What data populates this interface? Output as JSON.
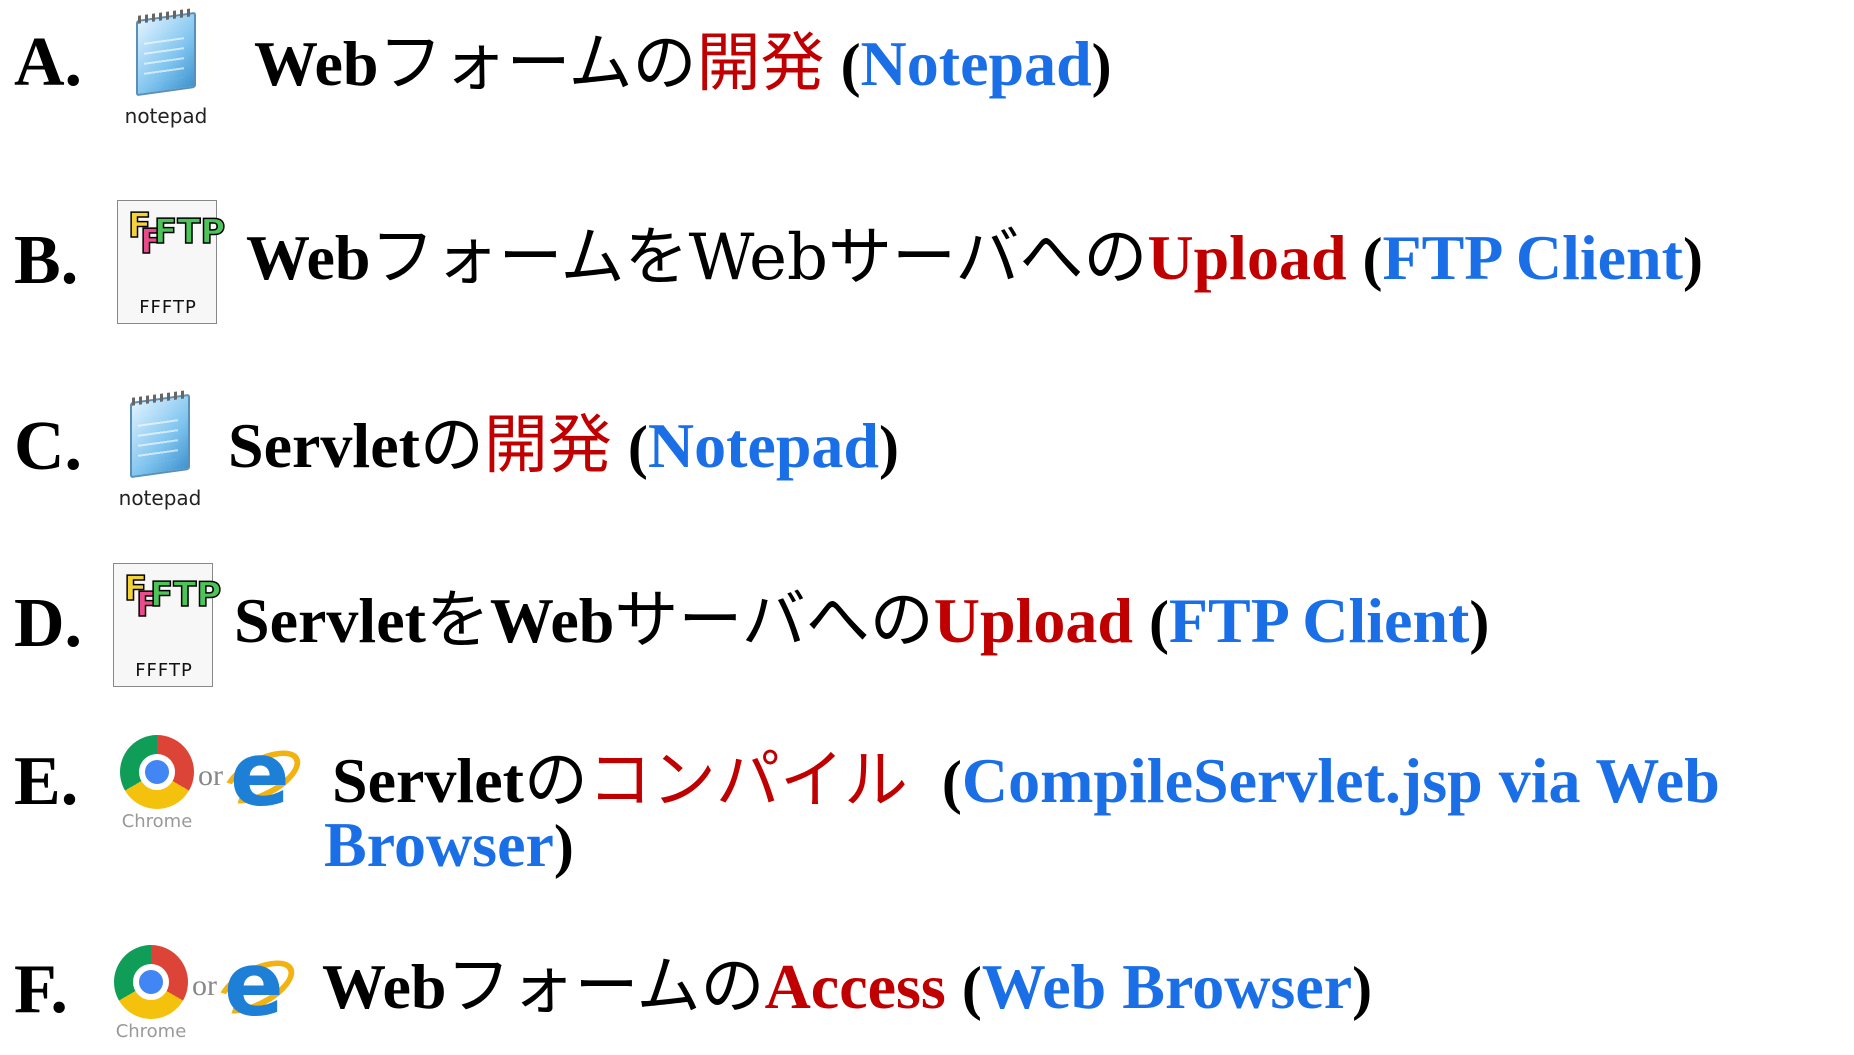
{
  "rows": [
    {
      "letter": "A.",
      "icon_label": "notepad",
      "parts": [
        "Web",
        "フォームの",
        "開発",
        "(",
        "Notepad",
        ")"
      ]
    },
    {
      "letter": "B.",
      "icon_label": "FFFTP",
      "parts": [
        "Web",
        "フォームを",
        "Web",
        "サーバへの",
        "Upload",
        "(",
        "FTP Client",
        ")"
      ]
    },
    {
      "letter": "C.",
      "icon_label": "notepad",
      "parts": [
        "Servlet",
        "の",
        "開発",
        "(",
        "Notepad",
        ")"
      ]
    },
    {
      "letter": "D.",
      "icon_label": "FFFTP",
      "parts": [
        "Servlet",
        "を",
        "Web",
        "サーバへの",
        "Upload",
        "(",
        "FTP Client",
        ")"
      ]
    },
    {
      "letter": "E.",
      "chrome_label": "Chrome",
      "or_text": "or",
      "parts": [
        "Servlet",
        "の",
        "コンパイル",
        "(",
        "CompileServlet.jsp via Web",
        "Browser",
        ")"
      ]
    },
    {
      "letter": "F.",
      "chrome_label": "Chrome",
      "or_text": "or",
      "parts": [
        "Web",
        "フォームの",
        "Access",
        "(",
        "Web Browser",
        ")"
      ]
    }
  ],
  "colors": {
    "red": "#c00000",
    "blue": "#1a6fe6",
    "black": "#000000"
  },
  "icons": [
    "notepad-icon",
    "ffftp-icon",
    "chrome-icon",
    "internet-explorer-icon"
  ]
}
